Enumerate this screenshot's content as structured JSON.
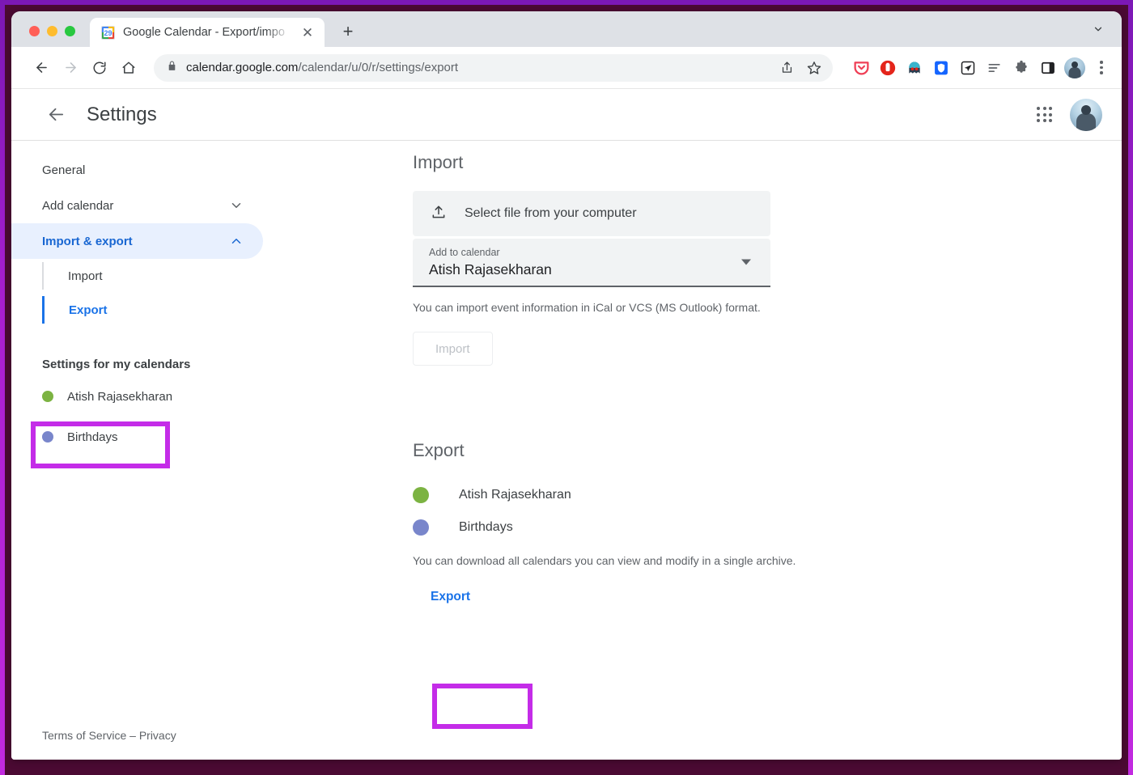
{
  "browser": {
    "traffic_lights": [
      "close",
      "minimize",
      "maximize"
    ],
    "tab": {
      "title": "Google Calendar - Export/impo",
      "favicon_label": "29",
      "close_label": "✕"
    },
    "newtab_label": "+",
    "tablist_icon": "chevron-down-icon",
    "toolbar": {
      "back_icon": "back-arrow-icon",
      "forward_icon": "forward-arrow-icon",
      "reload_icon": "reload-icon",
      "home_icon": "home-icon",
      "lock_icon": "lock-icon",
      "url_domain": "calendar.google.com",
      "url_path": "/calendar/u/0/r/settings/export",
      "share_icon": "share-icon",
      "bookmark_icon": "star-icon",
      "extensions": [
        "pocket-icon",
        "adblock-icon",
        "ghostery-icon",
        "dashlane-shield-icon",
        "send-paperplane-icon",
        "reading-list-icon",
        "puzzle-extensions-icon",
        "side-panel-icon"
      ],
      "profile_icon": "profile-avatar",
      "menu_icon": "kebab-menu-icon"
    }
  },
  "page": {
    "header": {
      "back_icon": "back-arrow-icon",
      "title": "Settings",
      "apps_icon": "google-apps-grid-icon",
      "avatar_icon": "account-avatar"
    },
    "sidebar": {
      "items": [
        {
          "label": "General",
          "type": "link"
        },
        {
          "label": "Add calendar",
          "type": "expandable",
          "expanded": false,
          "chevron": "chevron-down-icon"
        },
        {
          "label": "Import & export",
          "type": "expandable",
          "expanded": true,
          "chevron": "chevron-up-icon",
          "active": true
        }
      ],
      "sub_items": [
        {
          "label": "Import",
          "selected": false
        },
        {
          "label": "Export",
          "selected": true
        }
      ],
      "calendars_heading": "Settings for my calendars",
      "calendars": [
        {
          "name": "Atish Rajasekharan",
          "color": "#7cb342"
        },
        {
          "name": "Birthdays",
          "color": "#7986cb"
        }
      ]
    },
    "import": {
      "heading": "Import",
      "file_button_label": "Select file from your computer",
      "file_button_icon": "upload-icon",
      "select_label": "Add to calendar",
      "select_value": "Atish Rajasekharan",
      "select_caret_icon": "dropdown-caret-icon",
      "helper_text": "You can import event information in iCal or VCS (MS Outlook) format.",
      "import_button_label": "Import",
      "import_button_disabled": true
    },
    "export": {
      "heading": "Export",
      "calendars": [
        {
          "name": "Atish Rajasekharan",
          "color": "#7cb342"
        },
        {
          "name": "Birthdays",
          "color": "#7986cb"
        }
      ],
      "helper_text": "You can download all calendars you can view and modify in a single archive.",
      "export_button_label": "Export"
    },
    "footer_text": "Terms of Service – Privacy"
  },
  "annotations": {
    "color": "#c42ce8",
    "boxes": [
      "sidebar-export-item",
      "export-button"
    ]
  }
}
